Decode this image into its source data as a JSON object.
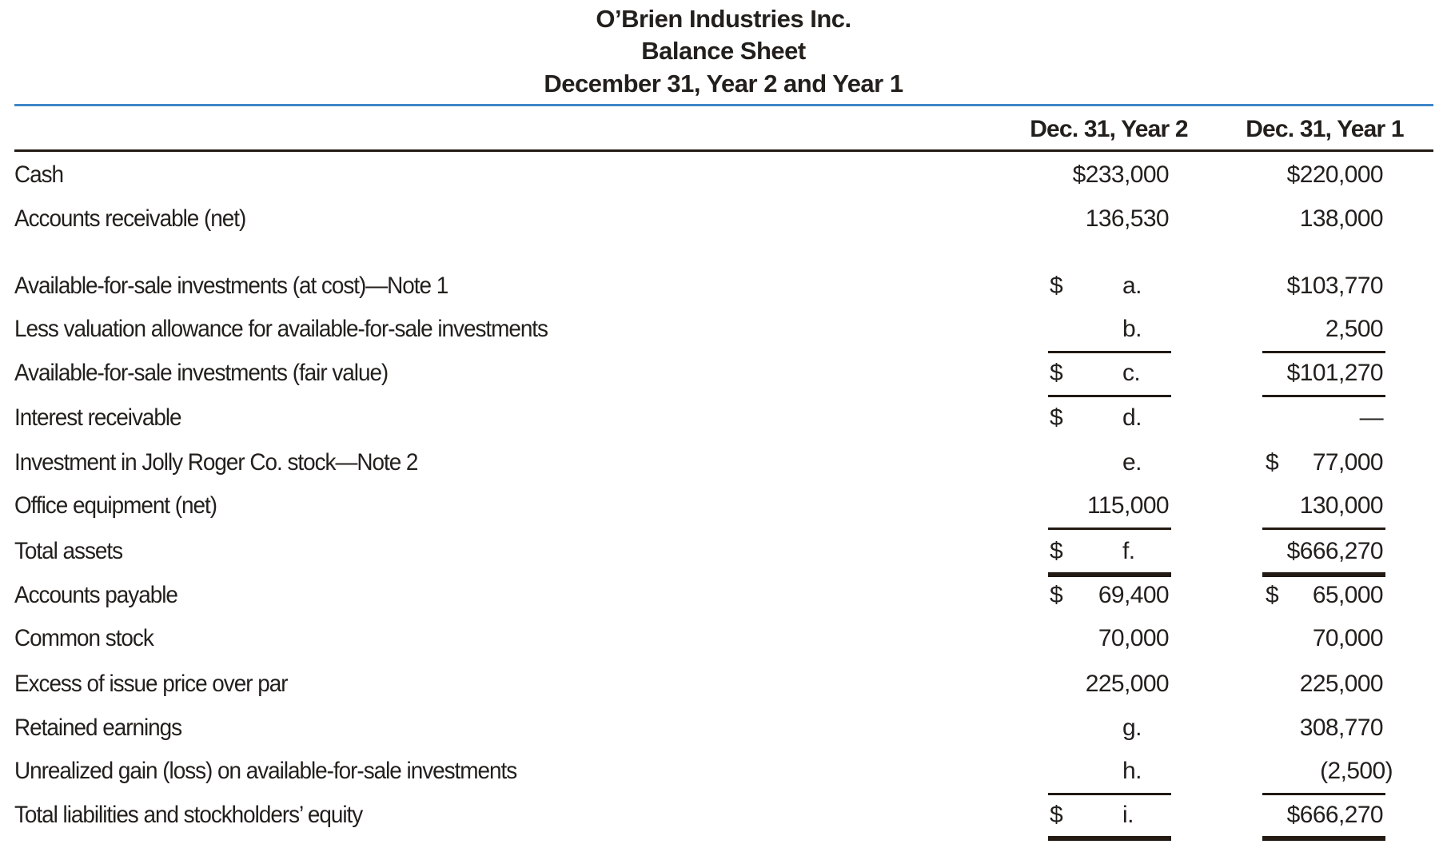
{
  "header": {
    "company": "O’Brien Industries Inc.",
    "statement": "Balance Sheet",
    "period": "December 31, Year 2 and Year 1"
  },
  "columns": [
    "Dec. 31, Year 2",
    "Dec. 31, Year 1"
  ],
  "rows": [
    {
      "label": "Cash",
      "y2": "$233,000",
      "y1": "$220,000"
    },
    {
      "label": "Accounts receivable (net)",
      "y2": "136,530",
      "y1": "138,000"
    },
    {
      "label": "Available-for-sale investments (at cost)—Note 1",
      "y2_dollar": "$",
      "y2": "a.",
      "y1": "$103,770"
    },
    {
      "label": "Less valuation allowance for available-for-sale investments",
      "y2": "b.",
      "y1": "2,500"
    },
    {
      "label": "Available-for-sale investments (fair value)",
      "y2_dollar": "$",
      "y2": "c.",
      "y1": "$101,270"
    },
    {
      "label": "Interest receivable",
      "y2_dollar": "$",
      "y2": "d.",
      "y1": "—"
    },
    {
      "label": "Investment in Jolly Roger Co. stock—Note 2",
      "y2": "e.",
      "y1_dollar": "$",
      "y1": "77,000"
    },
    {
      "label": "Office equipment (net)",
      "y2": "115,000",
      "y1": "130,000"
    },
    {
      "label": "Total assets",
      "y2_dollar": "$",
      "y2": "f.",
      "y1": "$666,270"
    },
    {
      "label": "Accounts payable",
      "y2_dollar": "$",
      "y2": "69,400",
      "y1_dollar": "$",
      "y1": "65,000"
    },
    {
      "label": "Common stock",
      "y2": "70,000",
      "y1": "70,000"
    },
    {
      "label": "Excess of issue price over par",
      "y2": "225,000",
      "y1": "225,000"
    },
    {
      "label": "Retained earnings",
      "y2": "g.",
      "y1": "308,770"
    },
    {
      "label": "Unrealized gain (loss) on available-for-sale investments",
      "y2": "h.",
      "y1": "(2,500)"
    },
    {
      "label": "Total liabilities and stockholders’ equity",
      "y2_dollar": "$",
      "y2": "i.",
      "y1": "$666,270"
    }
  ]
}
